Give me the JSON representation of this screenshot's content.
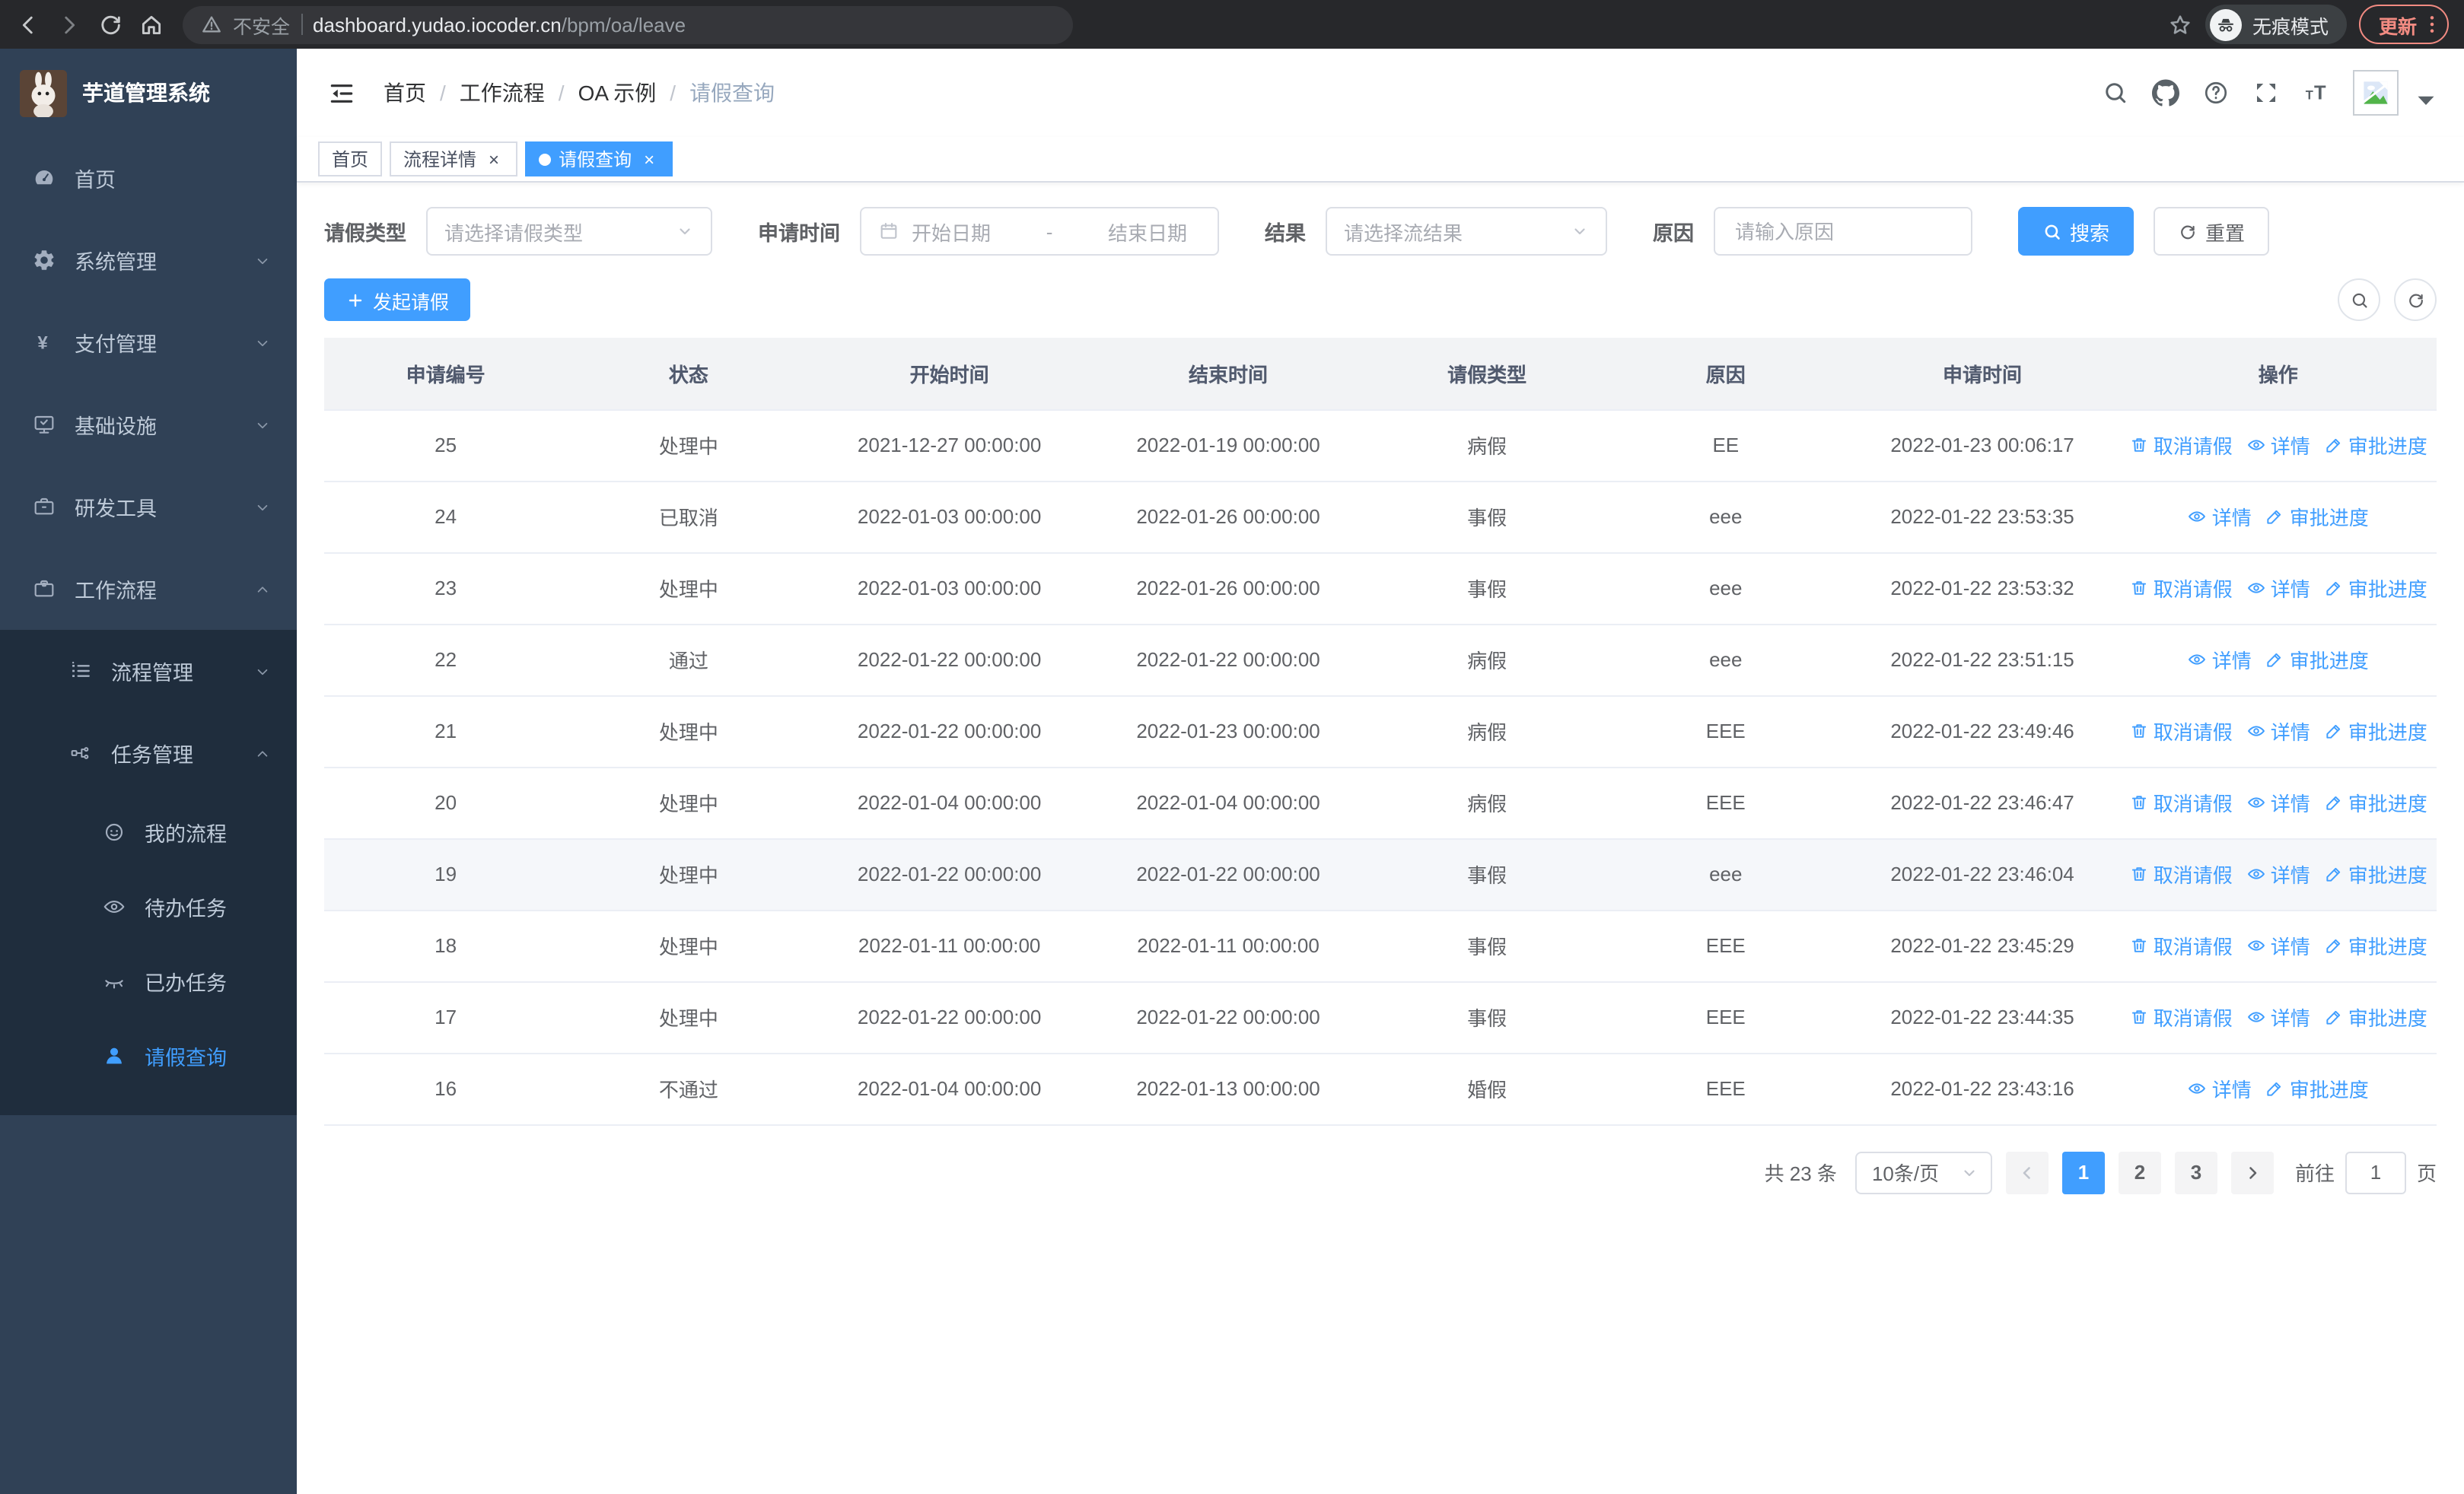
{
  "browser": {
    "security_label": "不安全",
    "url_host": "dashboard.yudao.iocoder.cn",
    "url_path": "/bpm/oa/leave",
    "incognito_label": "无痕模式",
    "update_label": "更新"
  },
  "sidebar": {
    "title": "芋道管理系统",
    "items": [
      {
        "label": "首页",
        "icon": "dashboard-icon",
        "level": 1
      },
      {
        "label": "系统管理",
        "icon": "gear-icon",
        "level": 1,
        "chevron": "down"
      },
      {
        "label": "支付管理",
        "icon": "yen-icon",
        "level": 1,
        "chevron": "down"
      },
      {
        "label": "基础设施",
        "icon": "monitor-icon",
        "level": 1,
        "chevron": "down"
      },
      {
        "label": "研发工具",
        "icon": "toolbox-icon",
        "level": 1,
        "chevron": "down"
      },
      {
        "label": "工作流程",
        "icon": "briefcase-icon",
        "level": 1,
        "chevron": "up"
      },
      {
        "label": "流程管理",
        "icon": "list-icon",
        "level": 2,
        "chevron": "down",
        "submenu": true
      },
      {
        "label": "任务管理",
        "icon": "tree-icon",
        "level": 2,
        "chevron": "up",
        "submenu": true
      },
      {
        "label": "我的流程",
        "icon": "face-icon",
        "level": 3,
        "submenu": true
      },
      {
        "label": "待办任务",
        "icon": "eye-icon",
        "level": 3,
        "submenu": true
      },
      {
        "label": "已办任务",
        "icon": "eye-closed-icon",
        "level": 3,
        "submenu": true
      },
      {
        "label": "请假查询",
        "icon": "user-icon",
        "level": 3,
        "submenu": true,
        "active": true
      }
    ]
  },
  "header": {
    "breadcrumb": [
      "首页",
      "工作流程",
      "OA 示例",
      "请假查询"
    ]
  },
  "tabs": [
    {
      "label": "首页",
      "active": false,
      "closable": false
    },
    {
      "label": "流程详情",
      "active": false,
      "closable": true
    },
    {
      "label": "请假查询",
      "active": true,
      "closable": true
    }
  ],
  "filters": {
    "type_label": "请假类型",
    "type_placeholder": "请选择请假类型",
    "time_label": "申请时间",
    "time_start_placeholder": "开始日期",
    "time_separator": "-",
    "time_end_placeholder": "结束日期",
    "result_label": "结果",
    "result_placeholder": "请选择流结果",
    "reason_label": "原因",
    "reason_placeholder": "请输入原因",
    "search_label": "搜索",
    "reset_label": "重置"
  },
  "toolbar": {
    "create_label": "发起请假"
  },
  "table": {
    "columns": [
      "申请编号",
      "状态",
      "开始时间",
      "结束时间",
      "请假类型",
      "原因",
      "申请时间",
      "操作"
    ],
    "action_labels": {
      "cancel": "取消请假",
      "detail": "详情",
      "progress": "审批进度"
    },
    "rows": [
      {
        "id": "25",
        "status": "处理中",
        "start": "2021-12-27 00:00:00",
        "end": "2022-01-19 00:00:00",
        "type": "病假",
        "reason": "EE",
        "applied": "2022-01-23 00:06:17",
        "actions": [
          "cancel",
          "detail",
          "progress"
        ],
        "highlight": false
      },
      {
        "id": "24",
        "status": "已取消",
        "start": "2022-01-03 00:00:00",
        "end": "2022-01-26 00:00:00",
        "type": "事假",
        "reason": "eee",
        "applied": "2022-01-22 23:53:35",
        "actions": [
          "detail",
          "progress"
        ],
        "highlight": false
      },
      {
        "id": "23",
        "status": "处理中",
        "start": "2022-01-03 00:00:00",
        "end": "2022-01-26 00:00:00",
        "type": "事假",
        "reason": "eee",
        "applied": "2022-01-22 23:53:32",
        "actions": [
          "cancel",
          "detail",
          "progress"
        ],
        "highlight": false
      },
      {
        "id": "22",
        "status": "通过",
        "start": "2022-01-22 00:00:00",
        "end": "2022-01-22 00:00:00",
        "type": "病假",
        "reason": "eee",
        "applied": "2022-01-22 23:51:15",
        "actions": [
          "detail",
          "progress"
        ],
        "highlight": false
      },
      {
        "id": "21",
        "status": "处理中",
        "start": "2022-01-22 00:00:00",
        "end": "2022-01-23 00:00:00",
        "type": "病假",
        "reason": "EEE",
        "applied": "2022-01-22 23:49:46",
        "actions": [
          "cancel",
          "detail",
          "progress"
        ],
        "highlight": false
      },
      {
        "id": "20",
        "status": "处理中",
        "start": "2022-01-04 00:00:00",
        "end": "2022-01-04 00:00:00",
        "type": "病假",
        "reason": "EEE",
        "applied": "2022-01-22 23:46:47",
        "actions": [
          "cancel",
          "detail",
          "progress"
        ],
        "highlight": false
      },
      {
        "id": "19",
        "status": "处理中",
        "start": "2022-01-22 00:00:00",
        "end": "2022-01-22 00:00:00",
        "type": "事假",
        "reason": "eee",
        "applied": "2022-01-22 23:46:04",
        "actions": [
          "cancel",
          "detail",
          "progress"
        ],
        "highlight": true
      },
      {
        "id": "18",
        "status": "处理中",
        "start": "2022-01-11 00:00:00",
        "end": "2022-01-11 00:00:00",
        "type": "事假",
        "reason": "EEE",
        "applied": "2022-01-22 23:45:29",
        "actions": [
          "cancel",
          "detail",
          "progress"
        ],
        "highlight": false
      },
      {
        "id": "17",
        "status": "处理中",
        "start": "2022-01-22 00:00:00",
        "end": "2022-01-22 00:00:00",
        "type": "事假",
        "reason": "EEE",
        "applied": "2022-01-22 23:44:35",
        "actions": [
          "cancel",
          "detail",
          "progress"
        ],
        "highlight": false
      },
      {
        "id": "16",
        "status": "不通过",
        "start": "2022-01-04 00:00:00",
        "end": "2022-01-13 00:00:00",
        "type": "婚假",
        "reason": "EEE",
        "applied": "2022-01-22 23:43:16",
        "actions": [
          "detail",
          "progress"
        ],
        "highlight": false
      }
    ]
  },
  "pagination": {
    "total_label": "共 23 条",
    "page_size": "10条/页",
    "pages": [
      "1",
      "2",
      "3"
    ],
    "current_page": "1",
    "goto_label": "前往",
    "goto_value": "1",
    "page_suffix": "页"
  },
  "colors": {
    "accent": "#409eff",
    "sidebar_bg": "#304156",
    "submenu_bg": "#1f2d3d",
    "update_badge": "#f28b82"
  }
}
